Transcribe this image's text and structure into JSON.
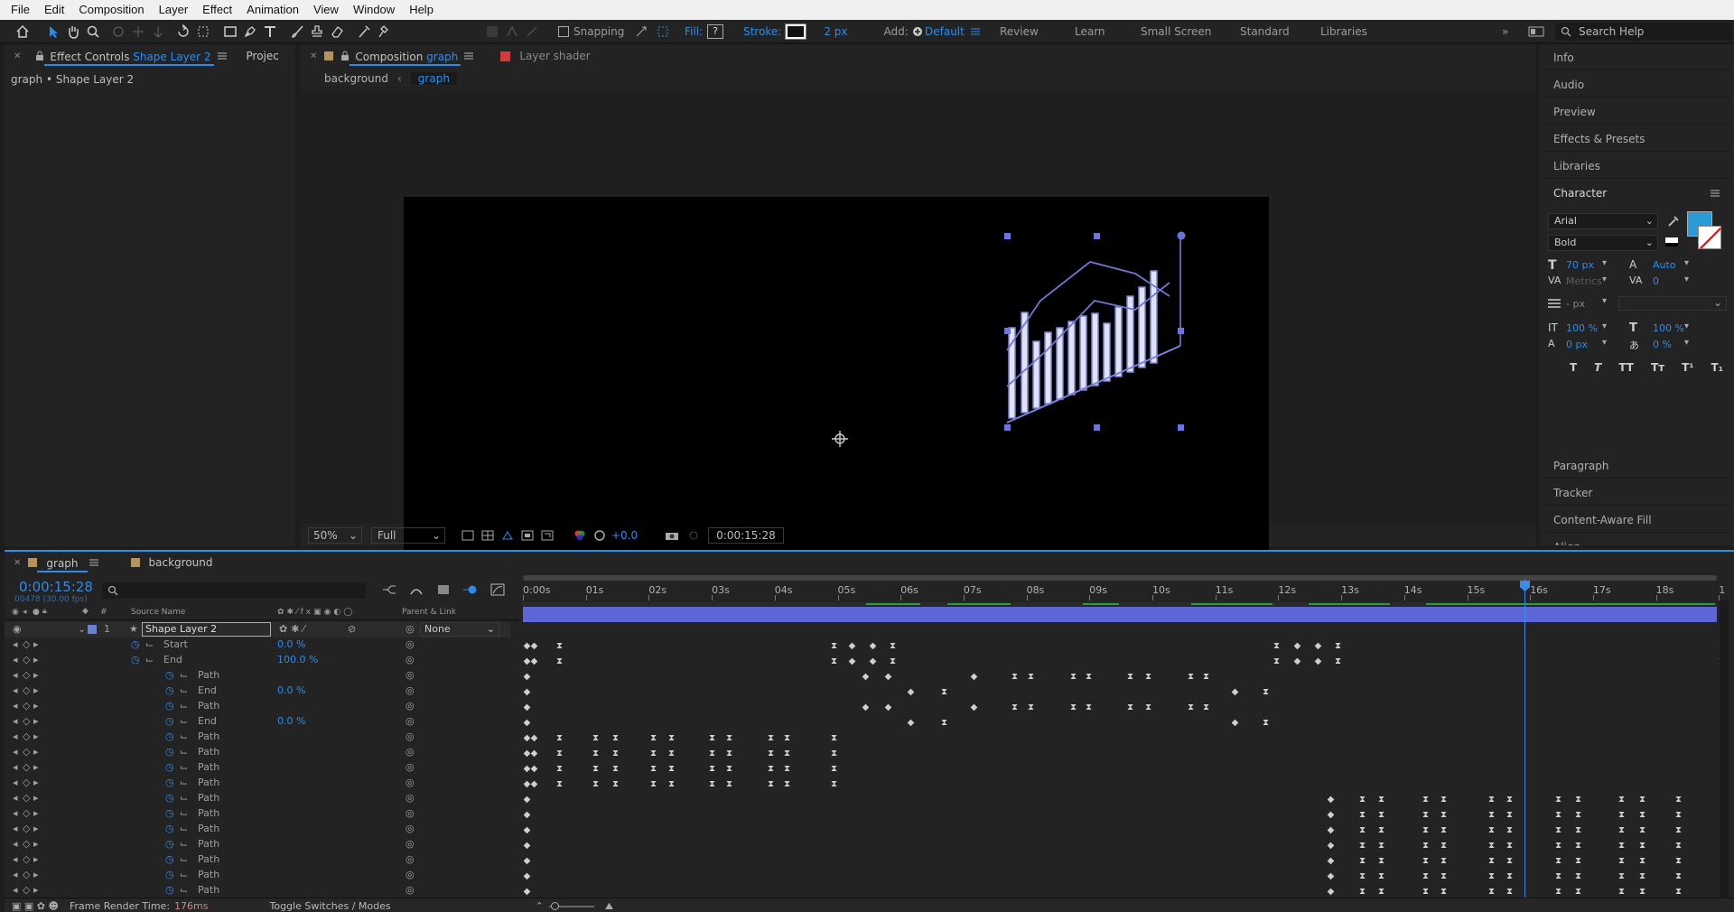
{
  "menu": [
    "File",
    "Edit",
    "Composition",
    "Layer",
    "Effect",
    "Animation",
    "View",
    "Window",
    "Help"
  ],
  "toolbar": {
    "snapping_label": "Snapping",
    "fill_label": "Fill:",
    "fill_value": "?",
    "stroke_label": "Stroke:",
    "stroke_width": "2 px",
    "add_label": "Add:",
    "workspaces": [
      "Default",
      "Review",
      "Learn",
      "Small Screen",
      "Standard",
      "Libraries"
    ],
    "active_workspace": "Default",
    "search_placeholder": "Search Help"
  },
  "effect_controls": {
    "tab_title": "Effect Controls",
    "tab_layer": "Shape Layer 2",
    "project_tab": "Projec",
    "breadcrumb": "graph • Shape Layer 2"
  },
  "composition": {
    "tab_title": "Composition",
    "tab_name": "graph",
    "layer_tab": "Layer  shader",
    "crumbs": [
      "background",
      "graph"
    ],
    "zoom": "50%",
    "resolution": "Full",
    "exposure": "+0.0",
    "timecode": "0:00:15:28"
  },
  "right_panel": {
    "items_top": [
      "Info",
      "Audio",
      "Preview",
      "Effects & Presets",
      "Libraries"
    ],
    "character_title": "Character",
    "font": "Arial",
    "style": "Bold",
    "font_size": "70 px",
    "leading": "Auto",
    "kerning": "Metrics",
    "tracking": "0",
    "stroke_px": "- px",
    "vscale": "100 %",
    "hscale": "100 %",
    "baseline": "0 px",
    "tsume": "0 %",
    "type_buttons": [
      "T",
      "T",
      "TT",
      "Tт",
      "T¹",
      "T₁"
    ],
    "items_bottom": [
      "Paragraph",
      "Tracker",
      "Content-Aware Fill",
      "Align"
    ],
    "fill_color": "#2a9ad8"
  },
  "timeline": {
    "tabs": [
      "graph",
      "background"
    ],
    "timecode": "0:00:15:28",
    "frame_info": "00478 (30.00 fps)",
    "col_source": "Source Name",
    "col_parent": "Parent & Link",
    "layer_num": "1",
    "layer_name": "Shape Layer 2",
    "parent": "None",
    "ruler": [
      "0:00s",
      "01s",
      "02s",
      "03s",
      "04s",
      "05s",
      "06s",
      "07s",
      "08s",
      "09s",
      "10s",
      "11s",
      "12s",
      "13s",
      "14s",
      "15s",
      "16s",
      "17s",
      "18s",
      "1"
    ],
    "props": [
      {
        "name": "Start",
        "value": "0.0 %"
      },
      {
        "name": "End",
        "value": "100.0 %"
      },
      {
        "name": "Path",
        "value": ""
      },
      {
        "name": "End",
        "value": "0.0 %"
      },
      {
        "name": "Path",
        "value": ""
      },
      {
        "name": "End",
        "value": "0.0 %"
      },
      {
        "name": "Path",
        "value": ""
      },
      {
        "name": "Path",
        "value": ""
      },
      {
        "name": "Path",
        "value": ""
      },
      {
        "name": "Path",
        "value": ""
      },
      {
        "name": "Path",
        "value": ""
      },
      {
        "name": "Path",
        "value": ""
      },
      {
        "name": "Path",
        "value": ""
      },
      {
        "name": "Path",
        "value": ""
      },
      {
        "name": "Path",
        "value": ""
      },
      {
        "name": "Path",
        "value": ""
      },
      {
        "name": "Path",
        "value": ""
      }
    ],
    "frame_render_label": "Frame Render Time:",
    "frame_render_value": "176ms",
    "toggle_label": "Toggle Switches / Modes",
    "accent": "#2d8ceb"
  }
}
